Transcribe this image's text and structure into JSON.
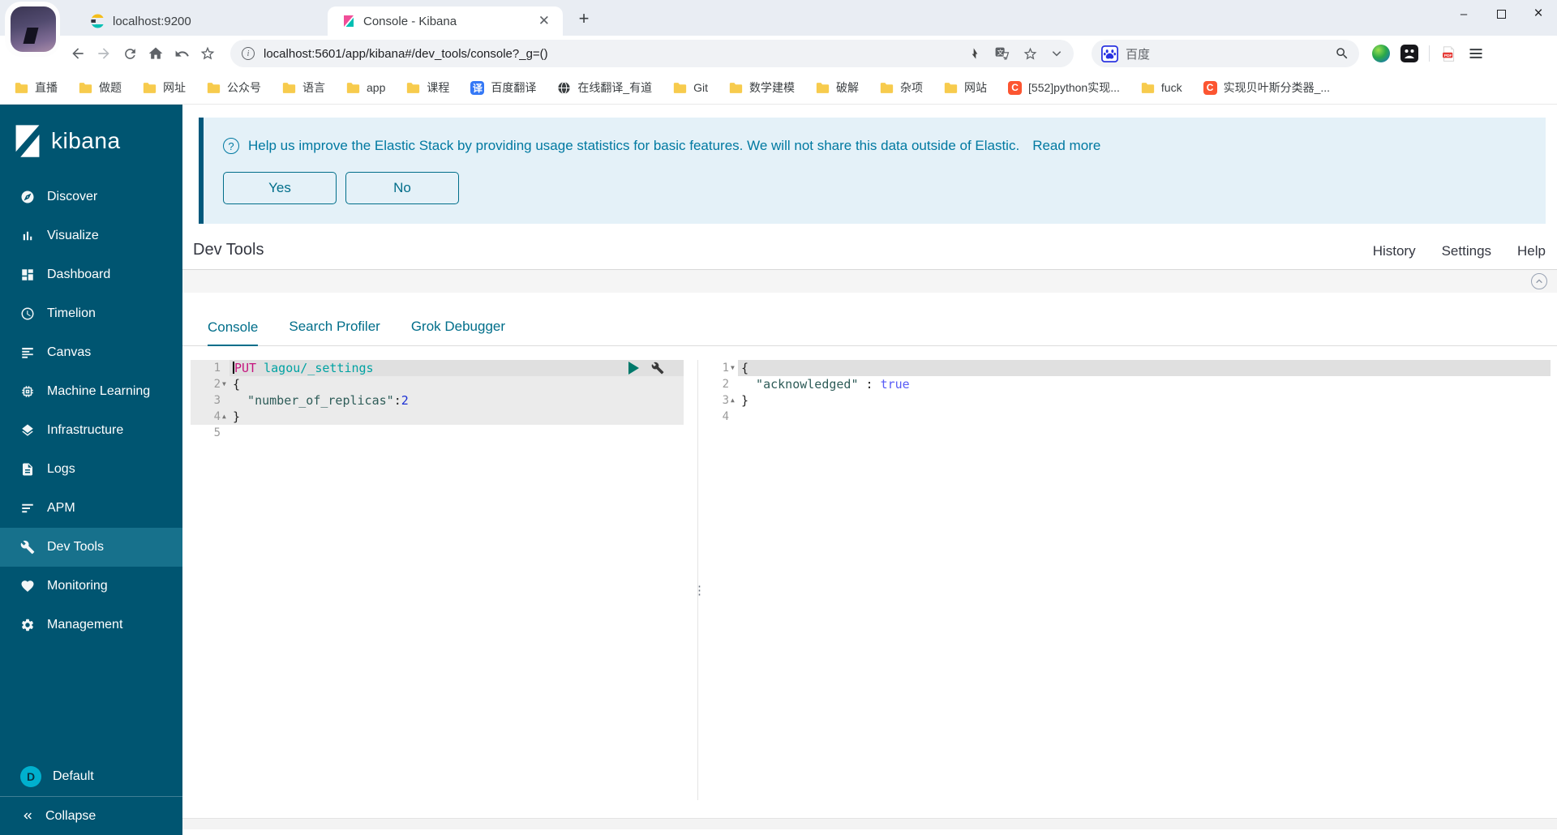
{
  "colors": {
    "sidebar_bg": "#005571",
    "sidebar_active_bg": "#17718c",
    "accent_teal": "#006e8a",
    "banner_bg": "#e4f1f8",
    "banner_border": "#00587c",
    "banner_text": "#0079a1",
    "default_badge_bg": "#00b0ce",
    "kibana_pink": "#f04e98",
    "kibana_teal": "#00bfb3"
  },
  "browser": {
    "tabs": [
      {
        "title": "localhost:9200",
        "icon": "elasticsearch-favicon",
        "active": false
      },
      {
        "title": "Console - Kibana",
        "icon": "kibana-favicon",
        "active": true
      }
    ],
    "new_tab_glyph": "+",
    "window_controls": {
      "minimize": "–",
      "maximize": "",
      "close": "×"
    },
    "url": "localhost:5601/app/kibana#/dev_tools/console?_g=()",
    "search_box": {
      "engine_label": "百度"
    },
    "bookmarks": [
      {
        "label": "直播",
        "icon": "folder"
      },
      {
        "label": "做题",
        "icon": "folder"
      },
      {
        "label": "网址",
        "icon": "folder"
      },
      {
        "label": "公众号",
        "icon": "folder"
      },
      {
        "label": "语言",
        "icon": "folder"
      },
      {
        "label": "app",
        "icon": "folder"
      },
      {
        "label": "课程",
        "icon": "folder"
      },
      {
        "label": "百度翻译",
        "icon": "translate"
      },
      {
        "label": "在线翻译_有道",
        "icon": "globe"
      },
      {
        "label": "Git",
        "icon": "folder"
      },
      {
        "label": "数学建模",
        "icon": "folder"
      },
      {
        "label": "破解",
        "icon": "folder"
      },
      {
        "label": "杂项",
        "icon": "folder"
      },
      {
        "label": "网站",
        "icon": "folder"
      },
      {
        "label": "[552]python实现...",
        "icon": "csdn"
      },
      {
        "label": "fuck",
        "icon": "folder"
      },
      {
        "label": "实现贝叶斯分类器_...",
        "icon": "csdn"
      }
    ]
  },
  "sidebar": {
    "logo_text": "kibana",
    "items": [
      {
        "label": "Discover",
        "icon": "discover",
        "active": false
      },
      {
        "label": "Visualize",
        "icon": "visualize",
        "active": false
      },
      {
        "label": "Dashboard",
        "icon": "dashboard",
        "active": false
      },
      {
        "label": "Timelion",
        "icon": "timelion",
        "active": false
      },
      {
        "label": "Canvas",
        "icon": "canvas",
        "active": false
      },
      {
        "label": "Machine Learning",
        "icon": "machine-learning",
        "active": false
      },
      {
        "label": "Infrastructure",
        "icon": "infrastructure",
        "active": false
      },
      {
        "label": "Logs",
        "icon": "logs",
        "active": false
      },
      {
        "label": "APM",
        "icon": "apm",
        "active": false
      },
      {
        "label": "Dev Tools",
        "icon": "wrench",
        "active": true
      },
      {
        "label": "Monitoring",
        "icon": "monitoring",
        "active": false
      },
      {
        "label": "Management",
        "icon": "management",
        "active": false
      }
    ],
    "footer": {
      "space_badge": "D",
      "space_label": "Default",
      "collapse_label": "Collapse"
    }
  },
  "banner": {
    "text": "Help us improve the Elastic Stack by providing usage statistics for basic features. We will not share this data outside of Elastic.",
    "link": "Read more",
    "yes_label": "Yes",
    "no_label": "No"
  },
  "devtools": {
    "title": "Dev Tools",
    "links": {
      "history": "History",
      "settings": "Settings",
      "help": "Help"
    },
    "tabs": [
      {
        "label": "Console",
        "active": true
      },
      {
        "label": "Search Profiler",
        "active": false
      },
      {
        "label": "Grok Debugger",
        "active": false
      }
    ]
  },
  "editor": {
    "request": {
      "lines": [
        {
          "n": "1",
          "hl": true,
          "blk": true,
          "cursor": true,
          "tokens": [
            {
              "t": "PUT ",
              "c": "method"
            },
            {
              "t": "lagou/_settings",
              "c": "url"
            }
          ]
        },
        {
          "n": "2",
          "blk": true,
          "fold": "down",
          "tokens": [
            {
              "t": "{",
              "c": "plain"
            }
          ]
        },
        {
          "n": "3",
          "blk": true,
          "tokens": [
            {
              "t": "  \"number_of_replicas\"",
              "c": "key"
            },
            {
              "t": ":",
              "c": "plain"
            },
            {
              "t": "2",
              "c": "num"
            }
          ]
        },
        {
          "n": "4",
          "blk": true,
          "fold": "up",
          "tokens": [
            {
              "t": "}",
              "c": "plain"
            }
          ]
        },
        {
          "n": "5",
          "tokens": []
        }
      ]
    },
    "response": {
      "lines": [
        {
          "n": "1",
          "hl": true,
          "fold": "down",
          "tokens": [
            {
              "t": "{",
              "c": "plain"
            }
          ]
        },
        {
          "n": "2",
          "tokens": [
            {
              "t": "  \"acknowledged\"",
              "c": "key"
            },
            {
              "t": " : ",
              "c": "plain"
            },
            {
              "t": "true",
              "c": "bool"
            }
          ]
        },
        {
          "n": "3",
          "fold": "up",
          "tokens": [
            {
              "t": "}",
              "c": "plain"
            }
          ]
        },
        {
          "n": "4",
          "tokens": []
        }
      ]
    }
  }
}
